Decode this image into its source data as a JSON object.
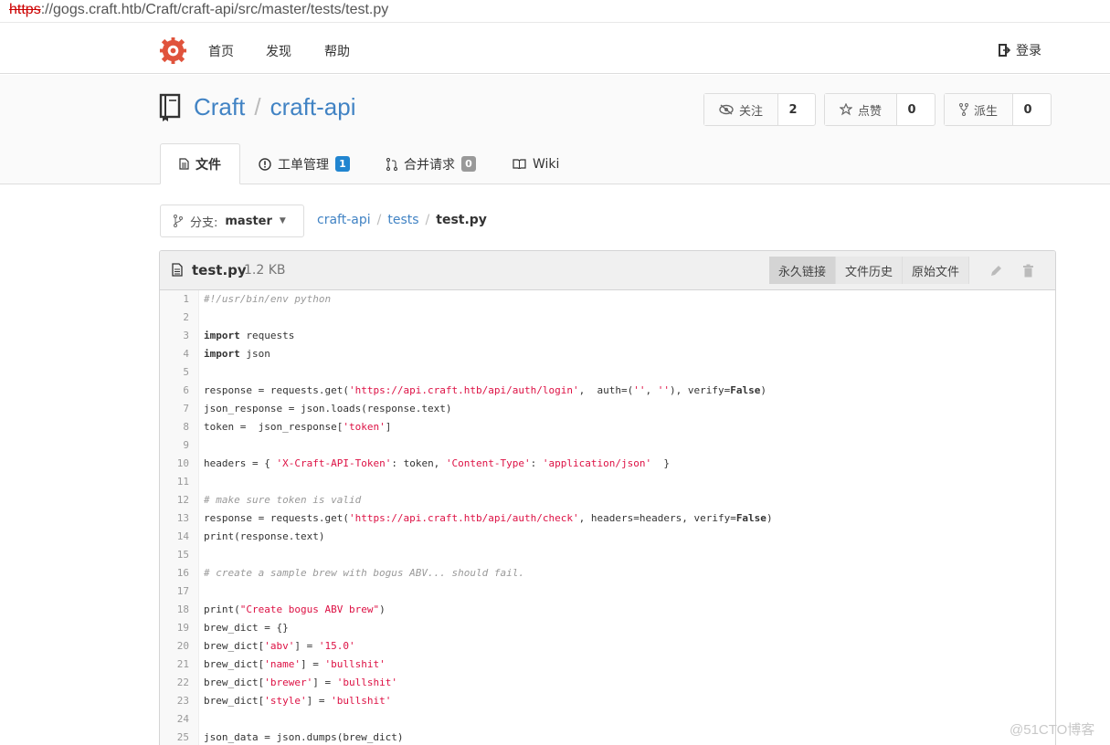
{
  "browser": {
    "url_scheme": "https",
    "url_rest": "://gogs.craft.htb/Craft/craft-api/src/master/tests/test.py"
  },
  "nav": {
    "items": [
      "首页",
      "发现",
      "帮助"
    ],
    "login": "登录"
  },
  "repo": {
    "owner": "Craft",
    "name": "craft-api",
    "watch": {
      "label": "关注",
      "count": "2"
    },
    "star": {
      "label": "点赞",
      "count": "0"
    },
    "fork": {
      "label": "派生",
      "count": "0"
    }
  },
  "tabs": [
    {
      "label": "文件",
      "badge": ""
    },
    {
      "label": "工单管理",
      "badge": "1"
    },
    {
      "label": "合并请求",
      "badge": "0"
    },
    {
      "label": "Wiki",
      "badge": ""
    }
  ],
  "branch": {
    "prefix": "分支:",
    "name": "master"
  },
  "breadcrumb": {
    "root": "craft-api",
    "dir": "tests",
    "file": "test.py"
  },
  "file": {
    "name": "test.py",
    "size": "1.2 KB",
    "buttons": [
      "永久链接",
      "文件历史",
      "原始文件"
    ],
    "lines": [
      [
        {
          "t": "#!/usr/bin/env python",
          "c": "cm"
        }
      ],
      [],
      [
        {
          "t": "import",
          "c": "kw"
        },
        {
          "t": " requests"
        }
      ],
      [
        {
          "t": "import",
          "c": "kw"
        },
        {
          "t": " json"
        }
      ],
      [],
      [
        {
          "t": "response = requests.get("
        },
        {
          "t": "'https://api.craft.htb/api/auth/login'",
          "c": "st"
        },
        {
          "t": ",  auth=("
        },
        {
          "t": "''",
          "c": "st"
        },
        {
          "t": ", "
        },
        {
          "t": "''",
          "c": "st"
        },
        {
          "t": "), verify="
        },
        {
          "t": "False",
          "c": "kw"
        },
        {
          "t": ")"
        }
      ],
      [
        {
          "t": "json_response = json.loads(response.text)"
        }
      ],
      [
        {
          "t": "token =  json_response["
        },
        {
          "t": "'token'",
          "c": "st"
        },
        {
          "t": "]"
        }
      ],
      [],
      [
        {
          "t": "headers = { "
        },
        {
          "t": "'X-Craft-API-Token'",
          "c": "st"
        },
        {
          "t": ": token, "
        },
        {
          "t": "'Content-Type'",
          "c": "st"
        },
        {
          "t": ": "
        },
        {
          "t": "'application/json'",
          "c": "st"
        },
        {
          "t": "  }"
        }
      ],
      [],
      [
        {
          "t": "# make sure token is valid",
          "c": "cm"
        }
      ],
      [
        {
          "t": "response = requests.get("
        },
        {
          "t": "'https://api.craft.htb/api/auth/check'",
          "c": "st"
        },
        {
          "t": ", headers=headers, verify="
        },
        {
          "t": "False",
          "c": "kw"
        },
        {
          "t": ")"
        }
      ],
      [
        {
          "t": "print(response.text)"
        }
      ],
      [],
      [
        {
          "t": "# create a sample brew with bogus ABV... should fail.",
          "c": "cm"
        }
      ],
      [],
      [
        {
          "t": "print("
        },
        {
          "t": "\"Create bogus ABV brew\"",
          "c": "st"
        },
        {
          "t": ")"
        }
      ],
      [
        {
          "t": "brew_dict = {}"
        }
      ],
      [
        {
          "t": "brew_dict["
        },
        {
          "t": "'abv'",
          "c": "st"
        },
        {
          "t": "] = "
        },
        {
          "t": "'15.0'",
          "c": "st"
        }
      ],
      [
        {
          "t": "brew_dict["
        },
        {
          "t": "'name'",
          "c": "st"
        },
        {
          "t": "] = "
        },
        {
          "t": "'bullshit'",
          "c": "st"
        }
      ],
      [
        {
          "t": "brew_dict["
        },
        {
          "t": "'brewer'",
          "c": "st"
        },
        {
          "t": "] = "
        },
        {
          "t": "'bullshit'",
          "c": "st"
        }
      ],
      [
        {
          "t": "brew_dict["
        },
        {
          "t": "'style'",
          "c": "st"
        },
        {
          "t": "] = "
        },
        {
          "t": "'bullshit'",
          "c": "st"
        }
      ],
      [],
      [
        {
          "t": "json_data = json.dumps(brew_dict)"
        }
      ]
    ]
  },
  "watermark": "@51CTO博客"
}
